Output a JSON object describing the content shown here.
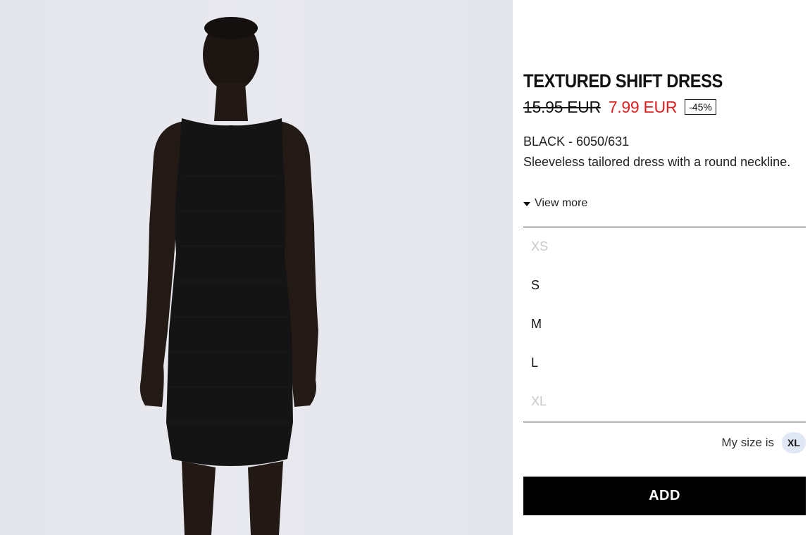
{
  "product": {
    "title": "TEXTURED SHIFT DRESS",
    "price_original": "15.95 EUR",
    "price_sale": "7.99 EUR",
    "discount": "-45%",
    "color_ref": "BLACK - 6050/631",
    "description": "Sleeveless tailored dress with a round neckline.",
    "view_more_label": "View more",
    "view_more_icon": "caret-down-icon"
  },
  "sizes": [
    {
      "label": "XS",
      "available": false
    },
    {
      "label": "S",
      "available": true
    },
    {
      "label": "M",
      "available": true
    },
    {
      "label": "L",
      "available": true
    },
    {
      "label": "XL",
      "available": false
    }
  ],
  "my_size": {
    "label": "My size is",
    "value": "XL"
  },
  "add_button_label": "ADD",
  "colors": {
    "sale_price": "#e02020",
    "unavailable_size": "#c8c8c8",
    "add_button_bg": "#000000",
    "my_size_badge_bg": "#dfe8f4",
    "photo_background": "#e6e7ec"
  }
}
